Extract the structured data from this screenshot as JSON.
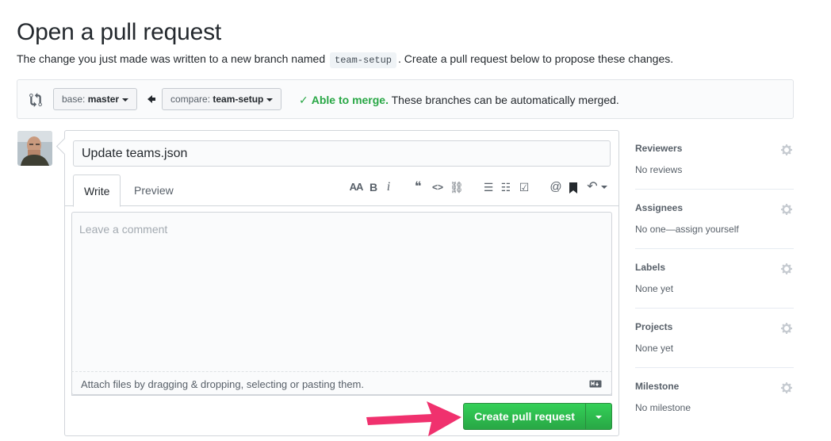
{
  "page": {
    "title": "Open a pull request",
    "subtitle_before": "The change you just made was written to a new branch named",
    "branch_name": "team-setup",
    "subtitle_after": ". Create a pull request below to propose these changes."
  },
  "range": {
    "base_label": "base:",
    "base_value": "master",
    "compare_label": "compare:",
    "compare_value": "team-setup",
    "merge_ok": "Able to merge.",
    "merge_text": "These branches can be automatically merged."
  },
  "form": {
    "title_value": "Update teams.json",
    "tab_write": "Write",
    "tab_preview": "Preview",
    "comment_placeholder": "Leave a comment",
    "attach_text": "Attach files by dragging & dropping, selecting or pasting them.",
    "submit_label": "Create pull request"
  },
  "toolbar": {
    "header": "AA",
    "bold": "B",
    "italic": "i",
    "quote": "❝",
    "code": "<>",
    "link": "⛓",
    "ul": "☰",
    "ol": "☷",
    "task": "☑",
    "mention": "@",
    "saved": "🔖",
    "reply": "↶"
  },
  "sidebar": {
    "reviewers": {
      "label": "Reviewers",
      "value": "No reviews"
    },
    "assignees": {
      "label": "Assignees",
      "value": "No one—assign yourself"
    },
    "labels": {
      "label": "Labels",
      "value": "None yet"
    },
    "projects": {
      "label": "Projects",
      "value": "None yet"
    },
    "milestone": {
      "label": "Milestone",
      "value": "No milestone"
    }
  },
  "colors": {
    "success": "#28a745",
    "annotation_arrow": "#f0316e"
  }
}
